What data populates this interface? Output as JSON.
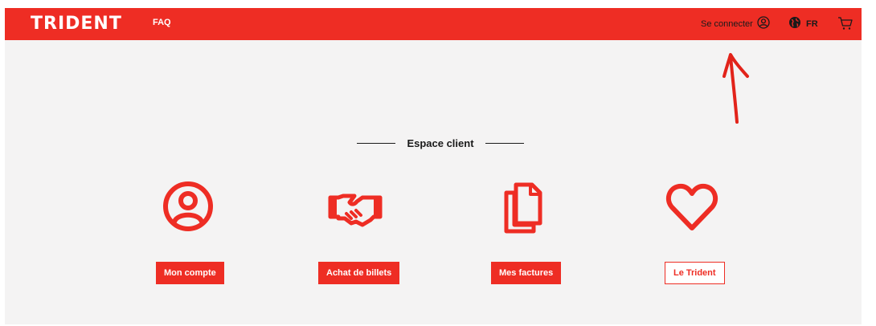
{
  "header": {
    "logo_text": "TRIDENT",
    "faq_label": "FAQ",
    "connect_label": "Se connecter",
    "lang_label": "FR"
  },
  "section": {
    "title": "Espace client"
  },
  "tiles": [
    {
      "icon": "user-circle-icon",
      "label": "Mon compte"
    },
    {
      "icon": "handshake-icon",
      "label": "Achat de billets"
    },
    {
      "icon": "documents-icon",
      "label": "Mes factures"
    },
    {
      "icon": "heart-icon",
      "label": "Le Trident"
    }
  ],
  "colors": {
    "brand_red": "#ee2d24",
    "background": "#f4f3f3",
    "text_dark": "#1a1a1a"
  },
  "icons": {
    "account": "user-circle-icon",
    "globe": "globe-icon",
    "cart": "cart-icon",
    "annotation": "red-arrow-annotation"
  }
}
